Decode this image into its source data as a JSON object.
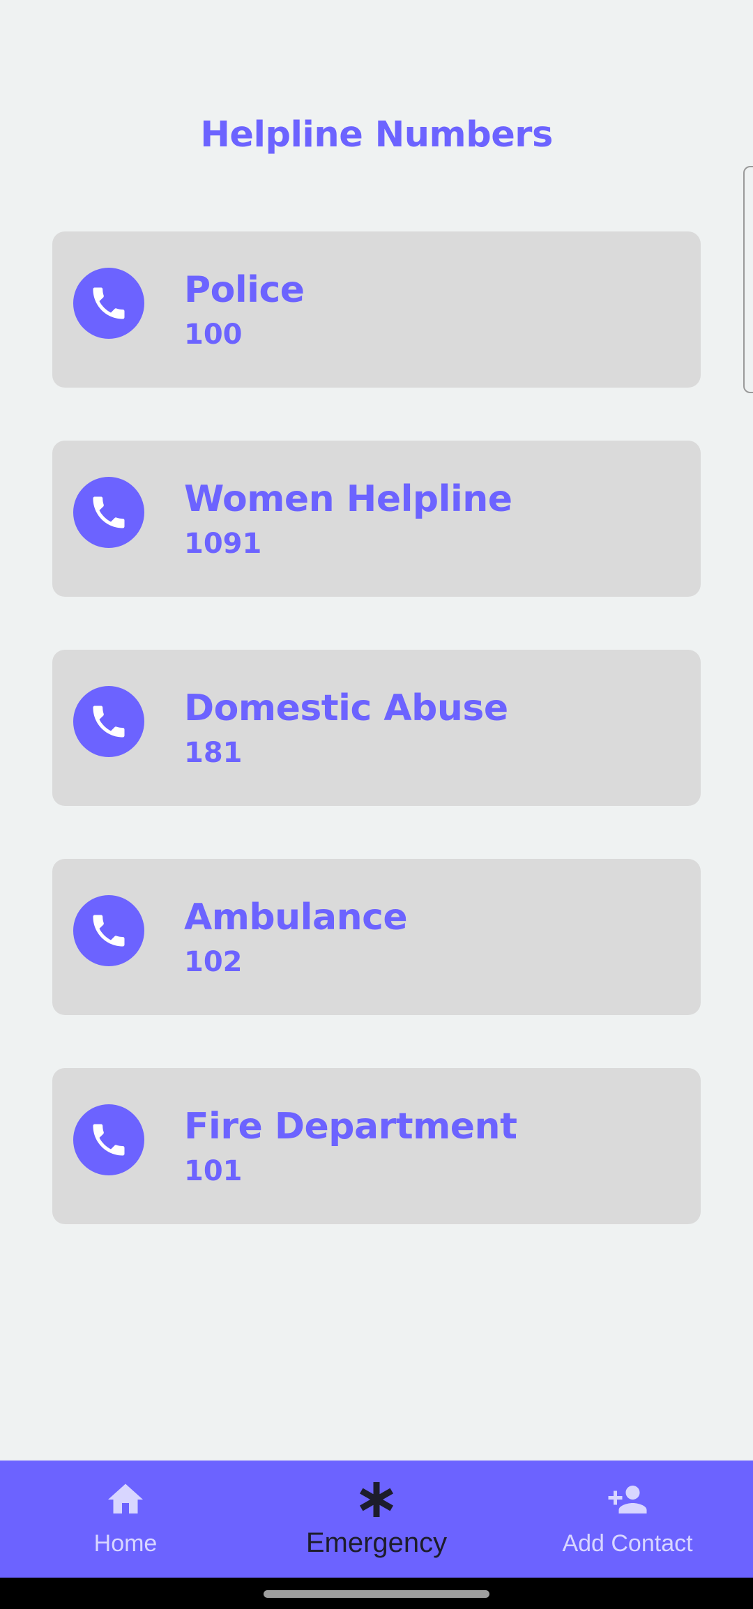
{
  "page": {
    "title": "Helpline Numbers"
  },
  "helplines": [
    {
      "name": "Police",
      "number": "100"
    },
    {
      "name": "Women Helpline",
      "number": "1091"
    },
    {
      "name": "Domestic Abuse",
      "number": "181"
    },
    {
      "name": "Ambulance",
      "number": "102"
    },
    {
      "name": "Fire Department",
      "number": "101"
    }
  ],
  "bottom_nav": {
    "items": [
      {
        "label": "Home",
        "icon": "home-icon"
      },
      {
        "label": "Emergency",
        "icon": "asterisk-icon",
        "active": true
      },
      {
        "label": "Add Contact",
        "icon": "add-person-icon"
      }
    ]
  },
  "colors": {
    "accent": "#6c63ff",
    "card_background": "#dadada",
    "page_background": "#eff2f2"
  }
}
